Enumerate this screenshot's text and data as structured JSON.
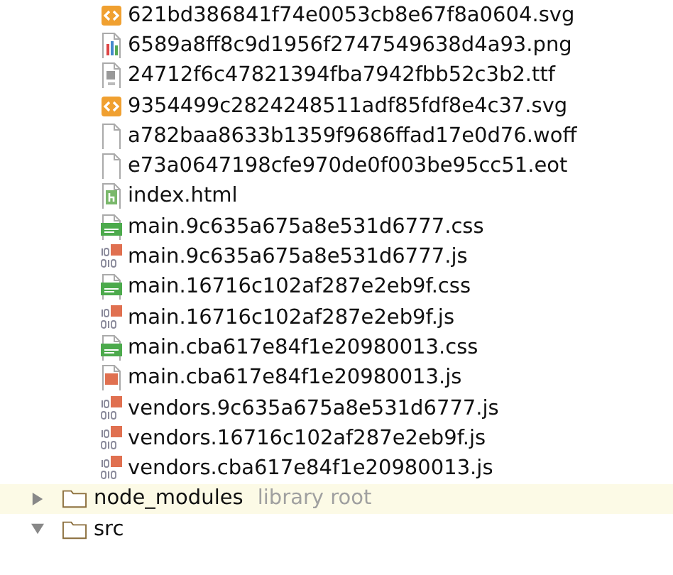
{
  "files": [
    {
      "name": "621bd386841f74e0053cb8e67f8a0604.svg",
      "kind": "svg"
    },
    {
      "name": "6589a8ff8c9d1956f2747549638d4a93.png",
      "kind": "image"
    },
    {
      "name": "24712f6c47821394fba7942fbb52c3b2.ttf",
      "kind": "font"
    },
    {
      "name": "9354499c2824248511adf85fdf8e4c37.svg",
      "kind": "svg"
    },
    {
      "name": "a782baa8633b1359f9686ffad17e0d76.woff",
      "kind": "plain"
    },
    {
      "name": "e73a0647198cfe970de0f003be95cc51.eot",
      "kind": "plain"
    },
    {
      "name": "index.html",
      "kind": "html"
    },
    {
      "name": "main.9c635a675a8e531d6777.css",
      "kind": "css"
    },
    {
      "name": "main.9c635a675a8e531d6777.js",
      "kind": "jsmin"
    },
    {
      "name": "main.16716c102af287e2eb9f.css",
      "kind": "css"
    },
    {
      "name": "main.16716c102af287e2eb9f.js",
      "kind": "jsmin"
    },
    {
      "name": "main.cba617e84f1e20980013.css",
      "kind": "css"
    },
    {
      "name": "main.cba617e84f1e20980013.js",
      "kind": "js"
    },
    {
      "name": "vendors.9c635a675a8e531d6777.js",
      "kind": "jsmin"
    },
    {
      "name": "vendors.16716c102af287e2eb9f.js",
      "kind": "jsmin"
    },
    {
      "name": "vendors.cba617e84f1e20980013.js",
      "kind": "jsmin"
    }
  ],
  "folders": [
    {
      "name": "node_modules",
      "note": "library root",
      "expanded": false,
      "highlighted": true
    },
    {
      "name": "src",
      "expanded": true,
      "highlighted": false
    }
  ]
}
